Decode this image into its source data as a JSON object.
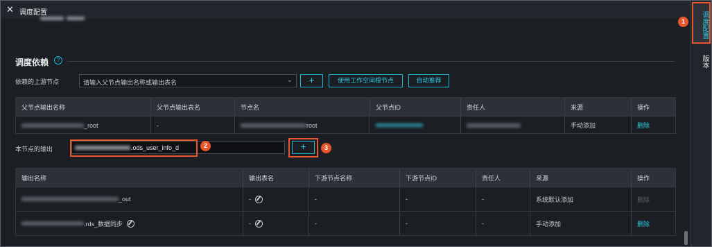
{
  "panel": {
    "close_icon": "close-icon",
    "title": "调度配置"
  },
  "section": {
    "title": "调度依赖"
  },
  "upstream": {
    "label": "依赖的上游节点",
    "placeholder": "请输入父节点输出名称或输出表名",
    "add_label": "+",
    "workspace_root_label": "使用工作空间根节点",
    "auto_recommend_label": "自动推荐"
  },
  "parent_table": {
    "headers": [
      "父节点输出名称",
      "父节点输出表名",
      "节点名",
      "父节点ID",
      "责任人",
      "来源",
      "操作"
    ],
    "rows": [
      {
        "output_name_suffix": "_root",
        "output_table": "-",
        "node_name_suffix": "root",
        "source": "手动添加",
        "action": "删除"
      }
    ]
  },
  "node_output": {
    "label": "本节点的输出",
    "value_suffix": ".ods_user_info_d",
    "add_label": "+"
  },
  "output_table": {
    "headers": [
      "输出名称",
      "输出表名",
      "下游节点名称",
      "下游节点ID",
      "责任人",
      "来源",
      "操作"
    ],
    "rows": [
      {
        "name_suffix": "_out",
        "table": "-",
        "downstream_name": "-",
        "downstream_id": "-",
        "owner": "-",
        "source": "系统默认添加",
        "action": "删除"
      },
      {
        "name_suffix": ".rds_数据同步",
        "table": "-",
        "downstream_name": "-",
        "downstream_id": "-",
        "owner": "-",
        "source": "手动添加",
        "action": "删除"
      }
    ]
  },
  "sidebar": {
    "tabs": [
      {
        "label": "调度配置"
      },
      {
        "label": "版本"
      }
    ]
  },
  "badges": [
    "1",
    "2",
    "3"
  ],
  "colors": {
    "accent": "#2ec7e0",
    "highlight": "#e8562b",
    "background": "#1b1e23"
  }
}
